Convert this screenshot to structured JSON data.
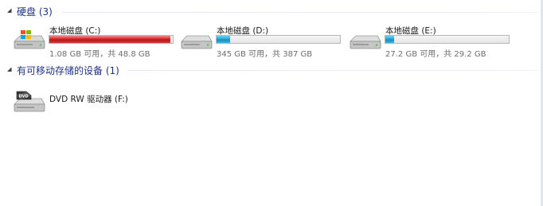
{
  "groups": {
    "hard_disks": {
      "title": "硬盘 (3)",
      "drives": [
        {
          "name": "本地磁盘 (C:)",
          "info": "1.08 GB 可用，共 48.8 GB",
          "used_fraction": 0.978
        },
        {
          "name": "本地磁盘 (D:)",
          "info": "345 GB 可用，共 387 GB",
          "used_fraction": 0.11
        },
        {
          "name": "本地磁盘 (E:)",
          "info": "27.2 GB 可用，共 29.2 GB",
          "used_fraction": 0.07
        }
      ]
    },
    "removable": {
      "title": "有可移动存储的设备 (1)",
      "drives": [
        {
          "name": "DVD RW 驱动器 (F:)"
        }
      ]
    }
  },
  "colors": {
    "group_title": "#1e3287",
    "bar_normal": "#2aa9d8",
    "bar_full": "#c81e1e"
  },
  "icons": {
    "expanded_chevron": "chevron-down-icon",
    "hard_disk_system": "windows-hard-drive-icon",
    "hard_disk": "hard-drive-icon",
    "dvd": "dvd-drive-icon"
  }
}
